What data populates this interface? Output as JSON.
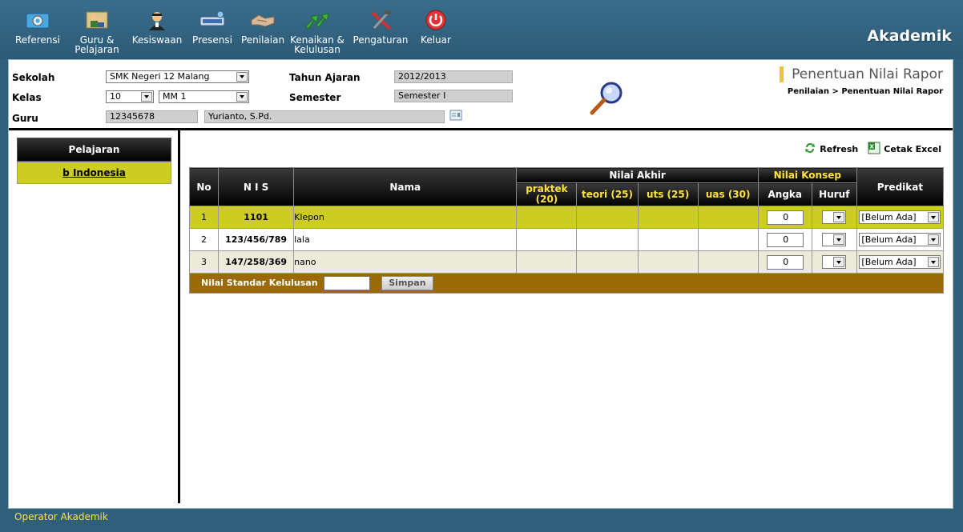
{
  "app": {
    "title": "Akademik"
  },
  "menu": [
    {
      "label": "Referensi",
      "icon": "gear-monitor-icon"
    },
    {
      "label": "Guru &\nPelajaran",
      "icon": "teacher-icon"
    },
    {
      "label": "Kesiswaan",
      "icon": "student-icon"
    },
    {
      "label": "Presensi",
      "icon": "keyboard-icon"
    },
    {
      "label": "Penilaian",
      "icon": "handshake-icon"
    },
    {
      "label": "Kenaikan &\nKelulusan",
      "icon": "arrows-icon"
    },
    {
      "label": "Pengaturan",
      "icon": "tools-icon"
    },
    {
      "label": "Keluar",
      "icon": "power-icon"
    }
  ],
  "filter": {
    "sekolah_label": "Sekolah",
    "sekolah_value": "SMK Negeri 12 Malang",
    "kelas_label": "Kelas",
    "kelas_value": "10",
    "rombel_value": "MM 1",
    "guru_label": "Guru",
    "guru_id": "12345678",
    "guru_name": "Yurianto, S.Pd.",
    "tahun_label": "Tahun Ajaran",
    "tahun_value": "2012/2013",
    "semester_label": "Semester",
    "semester_value": "Semester I"
  },
  "page": {
    "title": "Penentuan Nilai Rapor",
    "breadcrumb": "Penilaian >  Penentuan Nilai Rapor"
  },
  "sidebar": {
    "header": "Pelajaran",
    "items": [
      {
        "label": "b Indonesia"
      }
    ]
  },
  "actions": {
    "refresh": "Refresh",
    "excel": "Cetak Excel"
  },
  "table": {
    "headers": {
      "no": "No",
      "nis": "N I S",
      "nama": "Nama",
      "nilai_akhir": "Nilai Akhir",
      "praktek": "praktek (20)",
      "teori": "teori (25)",
      "uts": "uts (25)",
      "uas": "uas (30)",
      "nilai_konsep": "Nilai Konsep",
      "angka": "Angka",
      "huruf": "Huruf",
      "predikat": "Predikat"
    },
    "rows": [
      {
        "no": "1",
        "nis": "1101",
        "nama": "Klepon",
        "angka": "0",
        "predikat": "[Belum Ada]"
      },
      {
        "no": "2",
        "nis": "123/456/789",
        "nama": "lala",
        "angka": "0",
        "predikat": "[Belum Ada]"
      },
      {
        "no": "3",
        "nis": "147/258/369",
        "nama": "nano",
        "angka": "0",
        "predikat": "[Belum Ada]"
      }
    ],
    "footer_label": "Nilai Standar Kelulusan",
    "save_label": "Simpan"
  },
  "status": {
    "text": "Operator Akademik"
  },
  "colors": {
    "accent_yellow": "#ffe23a",
    "row_selected": "#cccc22",
    "footer_brown": "#9a6a08",
    "header_blue": "#2f5f7a"
  }
}
